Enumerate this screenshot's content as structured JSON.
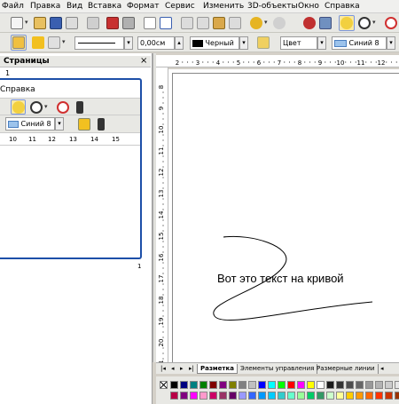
{
  "menu": [
    "Файл",
    "Правка",
    "Вид",
    "Вставка",
    "Формат",
    "Сервис",
    "Изменить",
    "3D-объекты",
    "Окно",
    "Справка"
  ],
  "toolbar2": {
    "line_width": "0,00см",
    "line_color": "Черный",
    "area_style": "Цвет",
    "area_color": "Синий 8"
  },
  "pages_pane": {
    "title": "Страницы",
    "close": "×",
    "page_number": "1"
  },
  "floating_toolbar": {
    "menu_label": "Справка",
    "color_value": "Синий 8",
    "ruler_ticks": [
      "10",
      "11",
      "12",
      "13",
      "14",
      "15"
    ],
    "left_mark": "1"
  },
  "hruler_ticks": [
    "2",
    "3",
    "4",
    "5",
    "6",
    "7",
    "8",
    "9",
    "10",
    "11",
    "12"
  ],
  "vruler_ticks": [
    "8",
    "9",
    "10",
    "11",
    "12",
    "13",
    "14",
    "15",
    "16",
    "17",
    "18",
    "19",
    "20",
    "21"
  ],
  "canvas": {
    "text": "Вот это текст на кривой"
  },
  "tabs": [
    "Разметка",
    "Элементы управления",
    "Размерные линии"
  ],
  "colors": {
    "palette_row1": [
      "#000000",
      "#000080",
      "#008080",
      "#008000",
      "#800000",
      "#800080",
      "#808000",
      "#808080",
      "#c0c0c0",
      "#0000ff",
      "#00ffff",
      "#00ff00",
      "#ff0000",
      "#ff00ff",
      "#ffff00",
      "#ffffff",
      "#1a1a1a",
      "#333333",
      "#4d4d4d",
      "#666666",
      "#999999",
      "#b3b3b3",
      "#cccccc",
      "#e6e6e6"
    ],
    "palette_row2": [
      "#b80047",
      "#800080",
      "#ff00ff",
      "#ff99cc",
      "#cc0066",
      "#993366",
      "#660066",
      "#9999ff",
      "#3366ff",
      "#0099ff",
      "#00ccff",
      "#33cccc",
      "#66ffcc",
      "#99ff99",
      "#00cc66",
      "#339966",
      "#ccffcc",
      "#ffff99",
      "#ffcc00",
      "#ff9900",
      "#ff6600",
      "#ff3300",
      "#cc3300",
      "#993300"
    ]
  }
}
